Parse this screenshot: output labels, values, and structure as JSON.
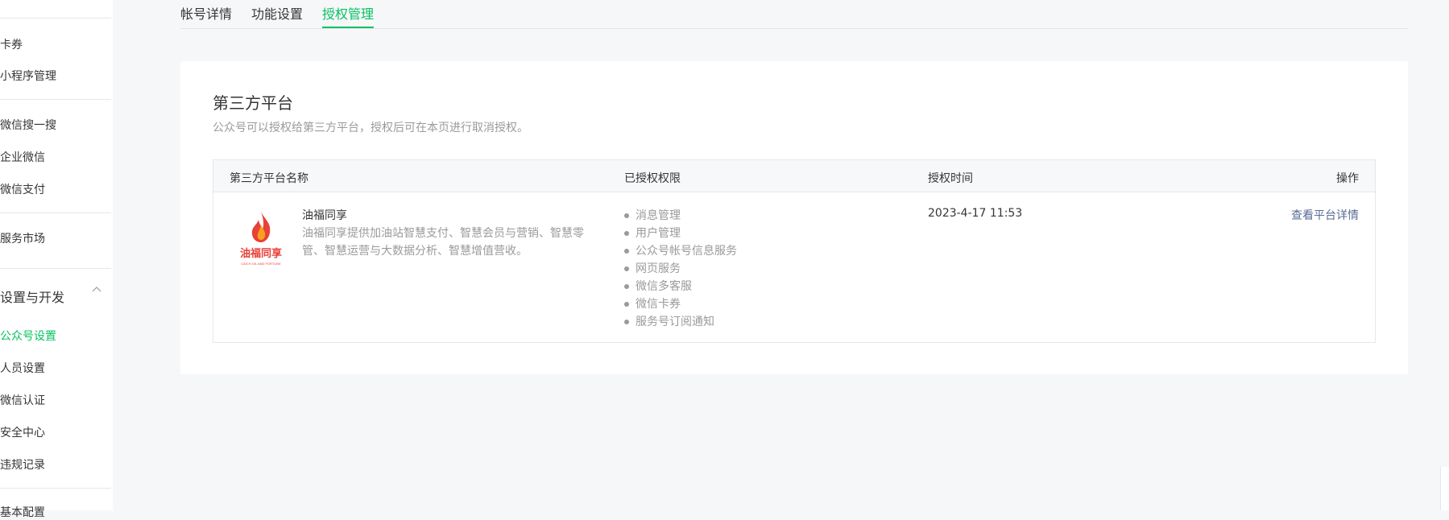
{
  "sidebar": {
    "items_top": [
      {
        "label": "卡券"
      },
      {
        "label": "小程序管理"
      }
    ],
    "items_mid": [
      {
        "label": "微信搜一搜"
      },
      {
        "label": "企业微信"
      },
      {
        "label": "微信支付"
      }
    ],
    "service_market": {
      "label": "服务市场"
    },
    "group": {
      "label": "设置与开发"
    },
    "settings_items": [
      {
        "label": "公众号设置",
        "active": true
      },
      {
        "label": "人员设置"
      },
      {
        "label": "微信认证"
      },
      {
        "label": "安全中心"
      },
      {
        "label": "违规记录"
      }
    ],
    "bottom_partial": {
      "label": "基本配置"
    }
  },
  "tabs": [
    {
      "label": "帐号详情"
    },
    {
      "label": "功能设置"
    },
    {
      "label": "授权管理",
      "active": true
    }
  ],
  "section": {
    "title": "第三方平台",
    "description": "公众号可以授权给第三方平台，授权后可在本页进行取消授权。"
  },
  "table": {
    "headers": {
      "name": "第三方平台名称",
      "permissions": "已授权权限",
      "time": "授权时间",
      "action": "操作"
    },
    "rows": [
      {
        "logo": {
          "text": "油福同享",
          "subtext": "CAICH OIL AND FORTUNE"
        },
        "name": "油福同享",
        "description": "油福同享提供加油站智慧支付、智慧会员与营销、智慧零管、智慧运营与大数据分析、智慧增值营收。",
        "permissions": [
          "消息管理",
          "用户管理",
          "公众号帐号信息服务",
          "网页服务",
          "微信多客服",
          "微信卡券",
          "服务号订阅通知"
        ],
        "time": "2023-4-17 11:53",
        "action": "查看平台详情"
      }
    ]
  },
  "colors": {
    "accent": "#07c160",
    "link": "#576b95",
    "muted": "#9a9a9a",
    "logo_red": "#e8413a"
  }
}
